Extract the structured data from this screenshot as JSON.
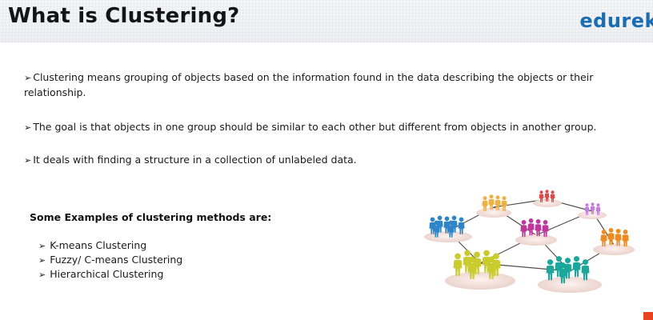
{
  "header": {
    "title": "What is Clustering?",
    "brand": "edurek"
  },
  "bullets": [
    "Clustering means grouping of objects based on the information found in the data describing the objects or their relationship.",
    "The goal is that objects in one group should be similar to each other but different from objects in another group.",
    "It deals with finding a structure in a collection of unlabeled data."
  ],
  "examples": {
    "heading": "Some Examples of clustering methods are:",
    "items": [
      "K-means Clustering",
      "Fuzzy/ C-means Clustering",
      "Hierarchical Clustering"
    ]
  },
  "colors": {
    "brand": "#1a6db3",
    "title": "#141414",
    "accent_corner": "#e8431c"
  },
  "icons": {
    "bullet": "arrow-bullet-icon",
    "illustration": "people-network-icon"
  }
}
